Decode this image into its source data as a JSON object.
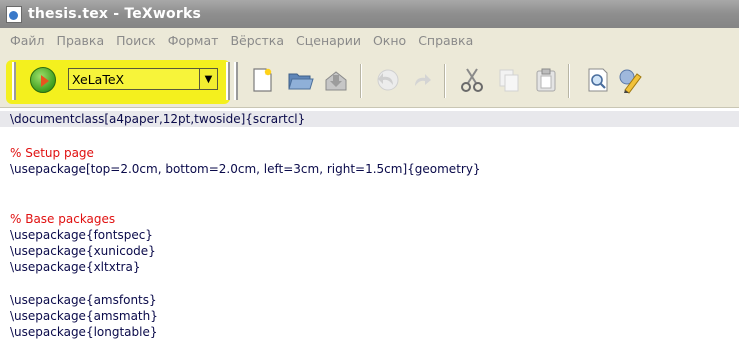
{
  "window": {
    "title": "thesis.tex - TeXworks"
  },
  "menu": {
    "items": [
      "Файл",
      "Правка",
      "Поиск",
      "Формат",
      "Вёрстка",
      "Сценарии",
      "Окно",
      "Справка"
    ]
  },
  "toolbar": {
    "engine_value": "XeLaTeX",
    "icons": [
      "new-document-icon",
      "open-folder-icon",
      "save-icon",
      "undo-icon",
      "redo-icon",
      "cut-icon",
      "copy-icon",
      "paste-icon",
      "find-icon",
      "edit-preferences-icon"
    ],
    "colors": {
      "highlight": "#f4f01e",
      "run": "#3f9e1e"
    }
  },
  "editor": {
    "lines": [
      "\\documentclass[a4paper,12pt,twoside]{scrartcl}",
      "",
      "% Setup page",
      "\\usepackage[top=2.0cm, bottom=2.0cm, left=3cm, right=1.5cm]{geometry}",
      "",
      "",
      "% Base packages",
      "\\usepackage{fontspec}",
      "\\usepackage{xunicode}",
      "\\usepackage{xltxtra}",
      "",
      "\\usepackage{amsfonts}",
      "\\usepackage{amsmath}",
      "\\usepackage{longtable}"
    ],
    "colors": {
      "command": "#2a2aa8",
      "comment": "#e01010"
    }
  }
}
